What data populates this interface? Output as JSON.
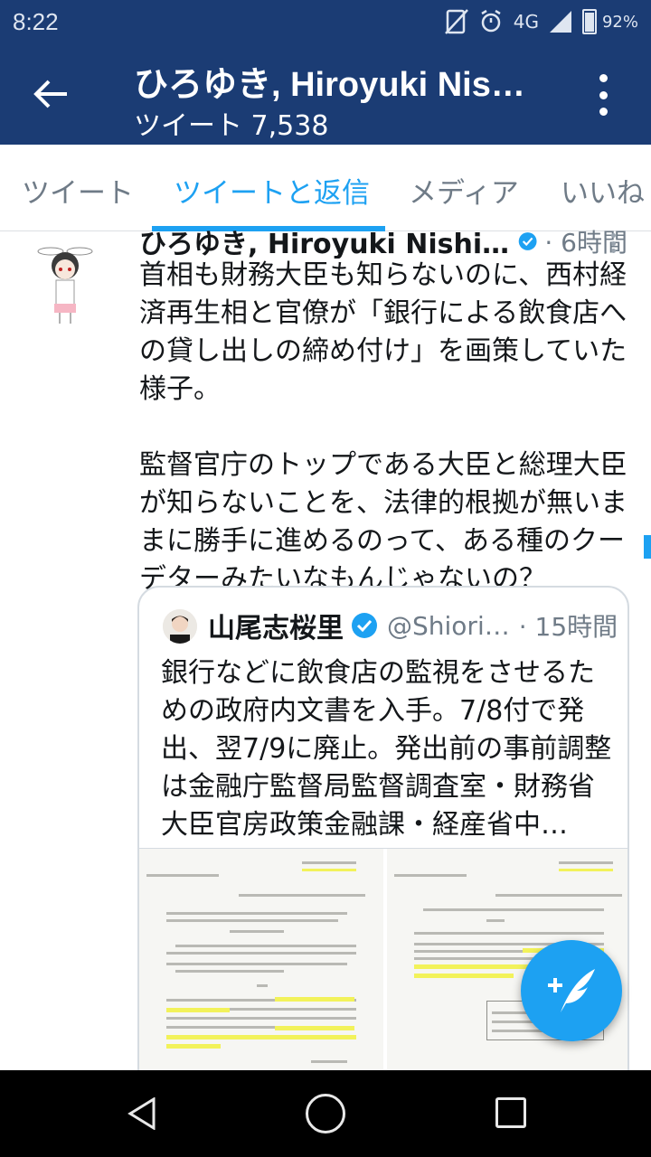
{
  "status_bar": {
    "time": "8:22",
    "network": "4G",
    "battery": "92%"
  },
  "app_bar": {
    "title": "ひろゆき, Hiroyuki Nis…",
    "subtitle": "ツイート 7,538"
  },
  "tabs": [
    {
      "label": "ツイート"
    },
    {
      "label": "ツイートと返信"
    },
    {
      "label": "メディア"
    },
    {
      "label": "いいね"
    }
  ],
  "active_tab": "ツイートと返信",
  "tweet": {
    "name": "ひろゆき, Hiroyuki Nishi…",
    "time": "· 6時間",
    "text": "首相も財務大臣も知らないのに、西村経済再生相と官僚が「銀行による飲食店への貸し出しの締め付け」を画策していた様子。\n\n監督官庁のトップである大臣と総理大臣が知らないことを、法律的根拠が無いままに勝手に進めるのって、ある種のクーデターみたいなもんじゃないの？"
  },
  "quoted_tweet": {
    "name": "山尾志桜里",
    "handle": "@Shiori…",
    "time": "· 15時間",
    "text": "銀行などに飲食店の監視をさせるための政府内文書を入手。7/8付で発出、翌7/9に廃止。発出前の事前調整は金融庁監督局監督調査室・財務省大臣官房政策金融課・経産省中…"
  },
  "colors": {
    "primary": "#1b3c74",
    "accent": "#1da1f2",
    "muted": "#6f7b87"
  }
}
